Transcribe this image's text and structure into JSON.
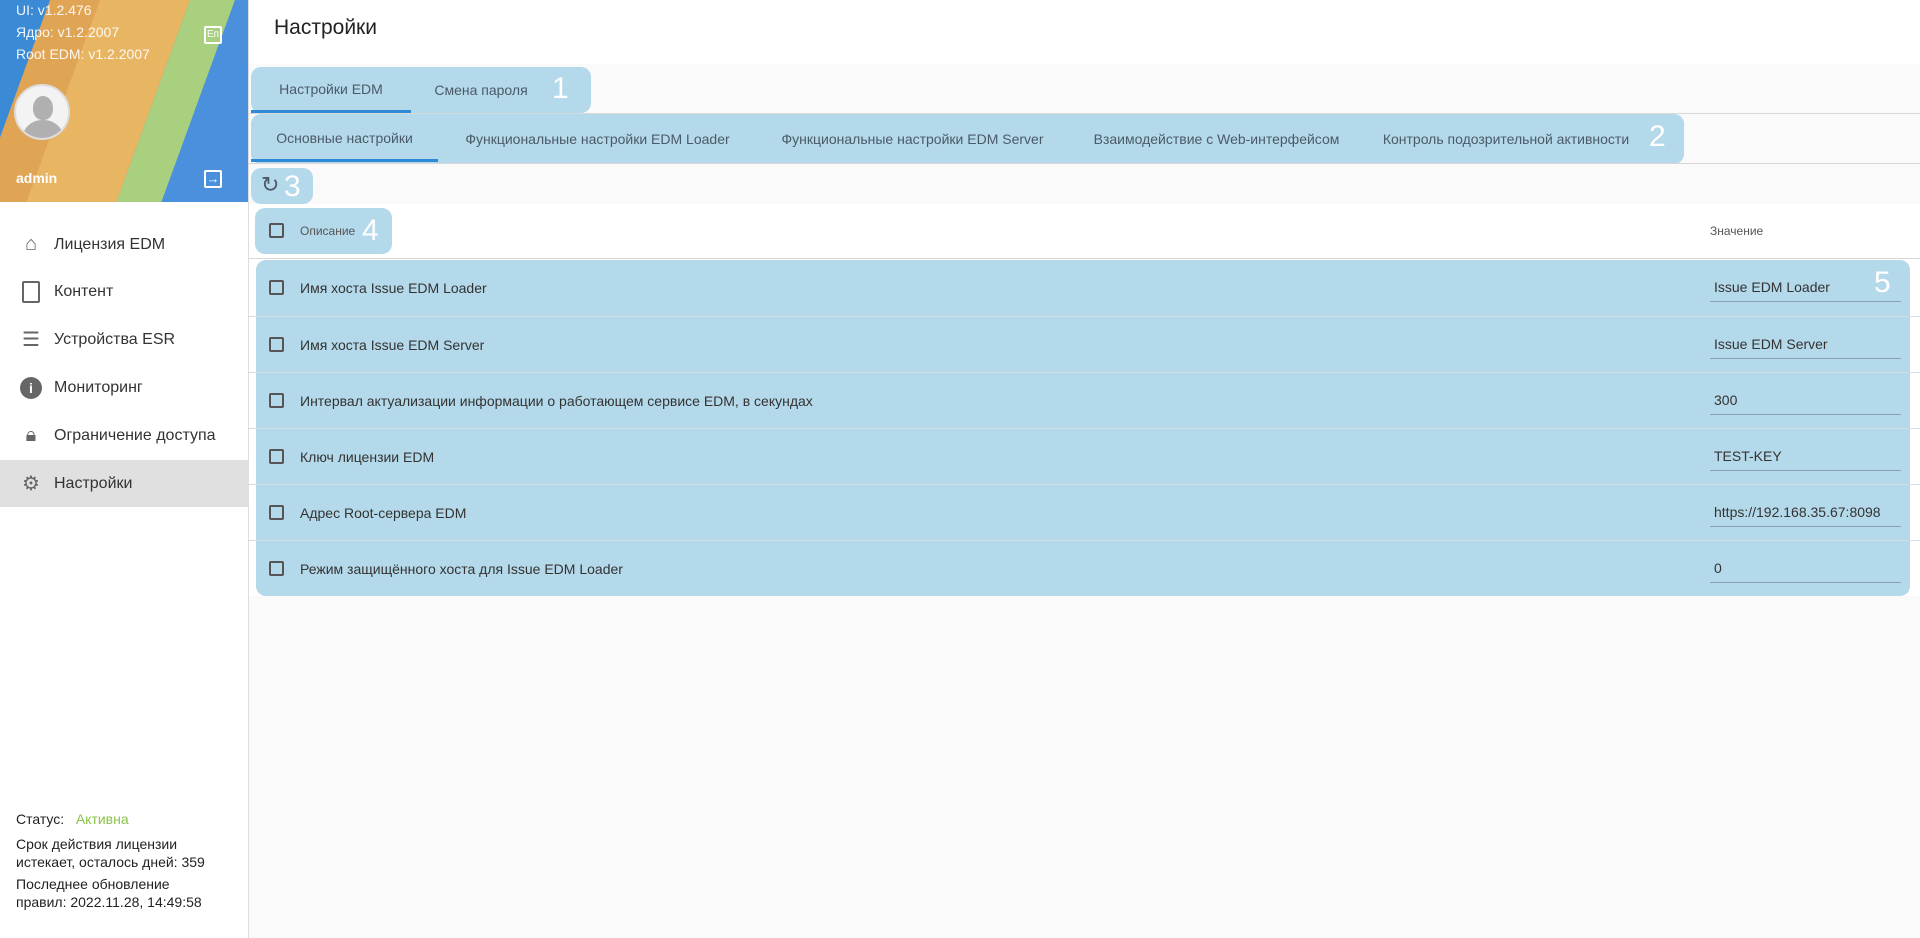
{
  "sidebar": {
    "versions": {
      "ui": "UI: v1.2.476",
      "core": "Ядро: v1.2.2007",
      "root": "Root EDM: v1.2.2007"
    },
    "user": "admin",
    "lang_icon": "Еп",
    "items": [
      {
        "label": "Лицензия EDM",
        "icon": "home-icon"
      },
      {
        "label": "Контент",
        "icon": "clipboard-icon"
      },
      {
        "label": "Устройства ESR",
        "icon": "server-icon"
      },
      {
        "label": "Мониторинг",
        "icon": "info-icon"
      },
      {
        "label": "Ограничение доступа",
        "icon": "lock-off-icon"
      },
      {
        "label": "Настройки",
        "icon": "gear-icon"
      }
    ],
    "status_label": "Статус:",
    "status_value": "Активна",
    "status_color": "#8bc34a",
    "license_line1": "Срок действия лицензии",
    "license_line2": "истекает, осталось дней: 359",
    "update_line1": "Последнее обновление",
    "update_line2": "правил: 2022.11.28, 14:49:58"
  },
  "header": {
    "title": "Настройки"
  },
  "tabs": [
    "Настройки EDM",
    "Смена пароля"
  ],
  "subtabs": [
    "Основные настройки",
    "Функциональные настройки EDM Loader",
    "Функциональные настройки EDM Server",
    "Взаимодействие с Web-интерфейсом",
    "Контроль подозрительной активности"
  ],
  "annotations": [
    "1",
    "2",
    "3",
    "4",
    "5"
  ],
  "table": {
    "col_desc": "Описание",
    "col_value": "Значение",
    "rows": [
      {
        "desc": "Имя хоста Issue EDM Loader",
        "value": "Issue EDM Loader"
      },
      {
        "desc": "Имя хоста Issue EDM Server",
        "value": "Issue EDM Server"
      },
      {
        "desc": "Интервал актуализации информации о работающем сервисе EDM, в секундах",
        "value": "300"
      },
      {
        "desc": "Ключ лицензии EDM",
        "value": "TEST-KEY"
      },
      {
        "desc": "Адрес Root-сервера EDM",
        "value": "https://192.168.35.67:8098"
      },
      {
        "desc": "Режим защищённого хоста для Issue EDM Loader",
        "value": "0"
      }
    ]
  }
}
